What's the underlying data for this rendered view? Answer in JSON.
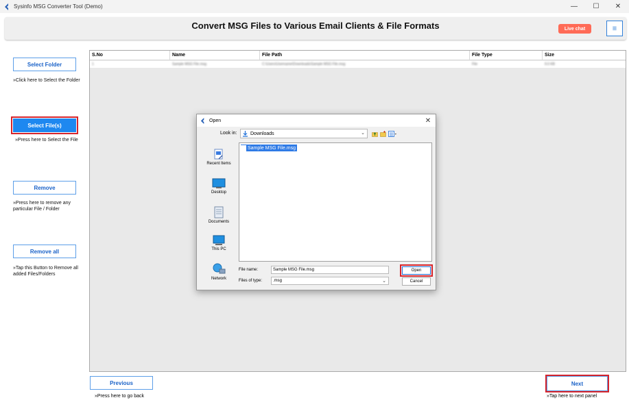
{
  "window": {
    "title": "Sysinfo MSG Converter Tool (Demo)",
    "minimize": "—",
    "maximize": "☐",
    "close": "✕"
  },
  "header": {
    "title": "Convert MSG Files to Various Email Clients & File Formats",
    "live_chat": "Live chat",
    "menu": "≡"
  },
  "left_panel": {
    "select_folder": "Select Folder",
    "select_folder_note": "»Click here to Select the Folder",
    "select_files": "Select File(s)",
    "select_files_note": "»Press here to Select the File",
    "remove": "Remove",
    "remove_note": "»Press here to remove any particular File / Folder",
    "remove_all": "Remove all",
    "remove_all_note": "»Tap this Button to Remove all added Files/Folders"
  },
  "table": {
    "headers": [
      "S.No",
      "Name",
      "File Path",
      "File Type",
      "Size"
    ],
    "rows": [
      [
        "1",
        "Sample MSG File.msg",
        "C:\\Users\\Username\\Downloads\\Sample MSG File.msg",
        "File",
        "9.0 KB"
      ]
    ]
  },
  "dialog": {
    "title": "Open",
    "close": "✕",
    "look_in_label": "Look in:",
    "look_in_value": "Downloads",
    "places": [
      "Recent Items",
      "Desktop",
      "Documents",
      "This PC",
      "Network"
    ],
    "files": [
      "Sample MSG File.msg"
    ],
    "file_name_label": "File name:",
    "file_name_value": "Sample MSG File.msg",
    "file_type_label": "Files of type:",
    "file_type_value": ".msg",
    "open": "Open",
    "cancel": "Cancel"
  },
  "footer": {
    "previous": "Previous",
    "previous_note": "»Press here to go back",
    "next": "Next",
    "next_note": "»Tap here to next panel"
  },
  "colors": {
    "accent": "#1e88f0",
    "highlight": "#d6242b",
    "live_chat": "#ff6b57",
    "selection": "#2f7be6"
  }
}
